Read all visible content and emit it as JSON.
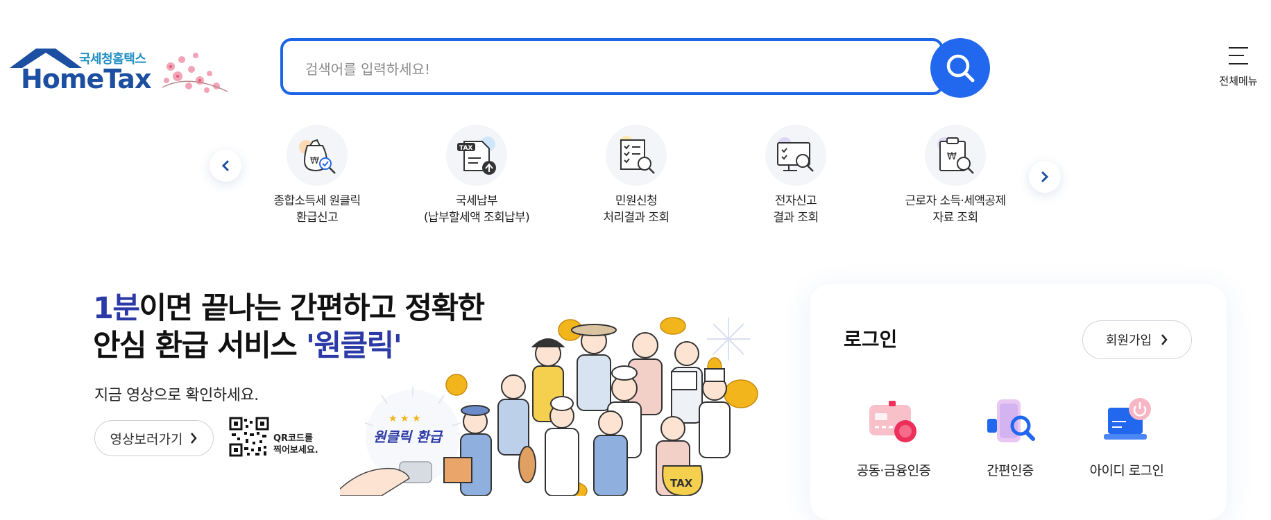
{
  "header": {
    "logo_sub": "국세청홈택스",
    "logo_main": "HomeTax",
    "search_placeholder": "검색어를 입력하세요!",
    "all_menu_label": "전체메뉴"
  },
  "quick_menu": [
    {
      "line1": "종합소득세 원클릭",
      "line2": "환급신고",
      "icon": "money-bag-search-icon"
    },
    {
      "line1": "국세납부",
      "line2": "(납부할세액 조회납부)",
      "icon": "tax-document-upload-icon"
    },
    {
      "line1": "민원신청",
      "line2": "처리결과 조회",
      "icon": "checklist-search-icon"
    },
    {
      "line1": "전자신고",
      "line2": "결과 조회",
      "icon": "monitor-search-icon"
    },
    {
      "line1": "근로자 소득·세액공제",
      "line2": "자료 조회",
      "icon": "clipboard-search-icon"
    }
  ],
  "promo": {
    "headline_em": "1분",
    "headline_rest1": "이면 끝나는 간편하고 정확한",
    "headline_line2": "안심 환급 서비스 ",
    "headline_em2": "'원클릭'",
    "subtitle": "지금 영상으로 확인하세요.",
    "video_button": "영상보러가기",
    "qr_line1": "QR코드를",
    "qr_line2": "찍어보세요.",
    "badge": "원클릭 환급",
    "bag_text": "TAX"
  },
  "login": {
    "title": "로그인",
    "join_button": "회원가입",
    "options": [
      {
        "label": "공동·금융인증",
        "icon": "certificate-card-icon"
      },
      {
        "label": "간편인증",
        "icon": "phone-search-icon"
      },
      {
        "label": "아이디 로그인",
        "icon": "laptop-power-icon"
      }
    ]
  },
  "colors": {
    "brand_blue": "#1c64e6",
    "logo_blue": "#1c4fa1",
    "logo_teal": "#1f8fc3",
    "headline_em": "#2b3aa6"
  }
}
